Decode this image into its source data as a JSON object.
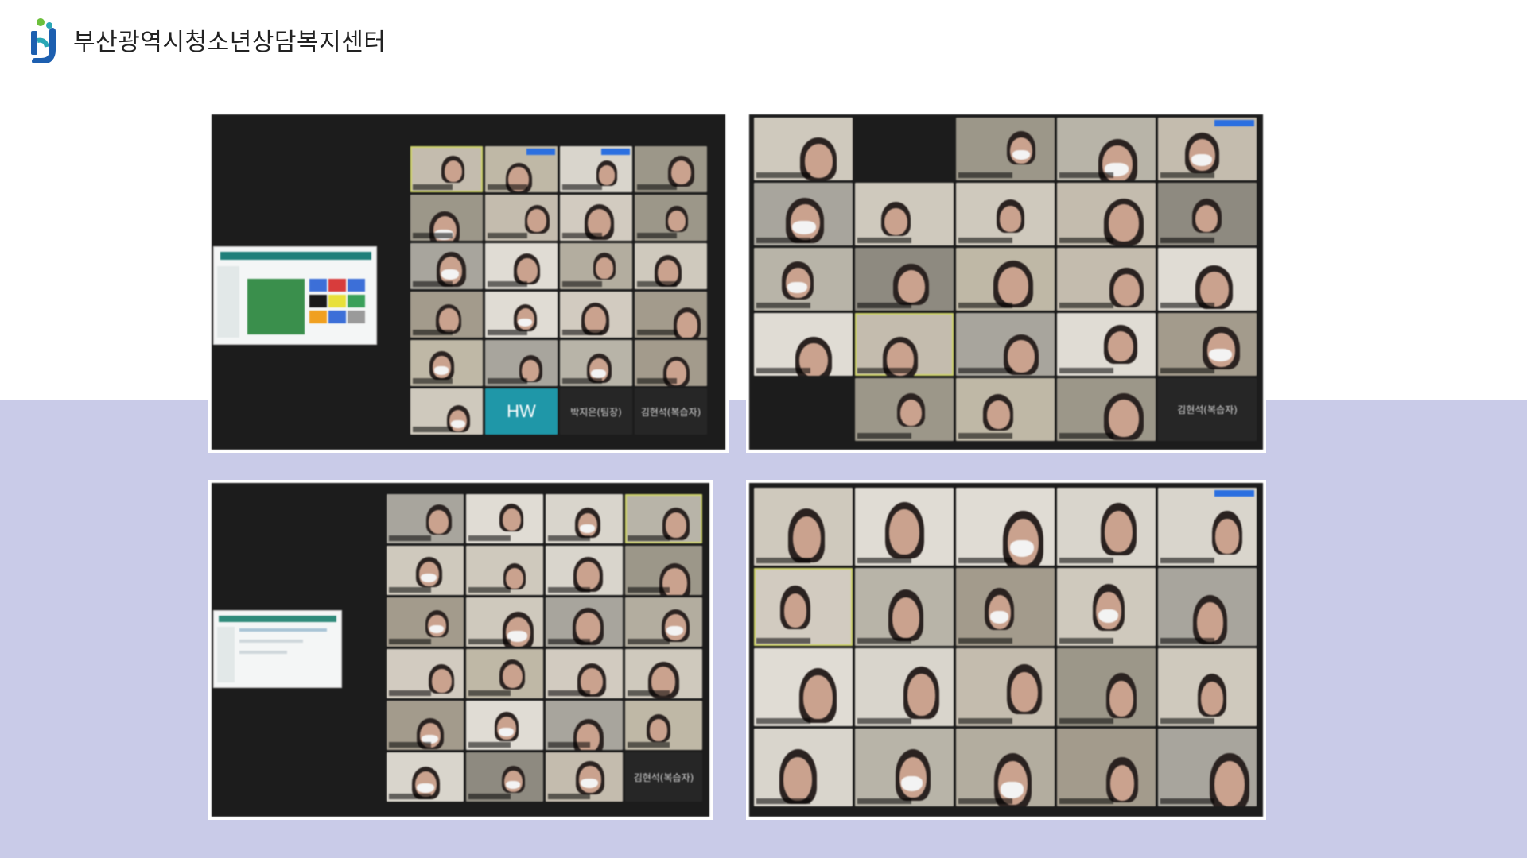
{
  "brand": {
    "name": "부산광역시청소년상담복지센터",
    "logo_icon": "busan-youth-counseling-logo",
    "colors": {
      "logo_blue": "#1d5fb0",
      "logo_green": "#6cbf3c",
      "logo_teal": "#2aa7b5",
      "band": "#c9cbe8"
    }
  },
  "screenshots": [
    {
      "id": "shot-1",
      "name_tiles": [
        "박지은(팀장)",
        "김현석(복습자)"
      ],
      "hw_label": "HW"
    },
    {
      "id": "shot-2",
      "name_tiles": [
        "김현석(복습자)"
      ]
    },
    {
      "id": "shot-3",
      "name_tiles": [
        "김현석(복습자)"
      ]
    },
    {
      "id": "shot-4",
      "name_tiles": []
    }
  ]
}
